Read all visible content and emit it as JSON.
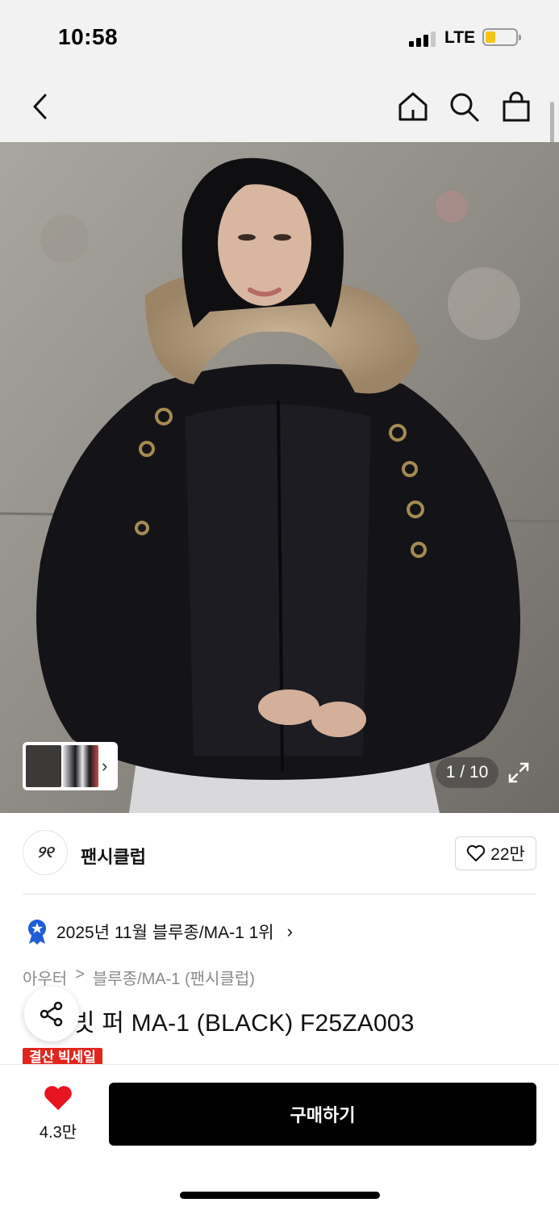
{
  "status_bar": {
    "time": "10:58",
    "network": "LTE",
    "battery_color": "#f5c518"
  },
  "nav": {
    "back_icon": "chevron-left-icon",
    "home_icon": "home-icon",
    "search_icon": "search-icon",
    "cart_icon": "shopping-bag-icon"
  },
  "gallery": {
    "counter": "1 / 10",
    "expand_icon": "expand-icon",
    "thumbnail_arrow": "›"
  },
  "brand": {
    "logo_text": "୨୧",
    "name": "팬시클럽",
    "likes": "22만"
  },
  "ranking": {
    "text": "2025년 11월 블루종/MA-1 1위",
    "badge_icon": "ranking-medal-icon",
    "badge_color": "#1f5fd6"
  },
  "breadcrumb": {
    "category": "아우터",
    "separator": ">",
    "subcategory": "블루종/MA-1 (팬시클럽)"
  },
  "product": {
    "title": "빗 퍼 MA-1 (BLACK) F25ZA003",
    "sale_badge": "결산 빅세일",
    "sale_color": "#e0261c"
  },
  "bottom_bar": {
    "wish_count": "4.3만",
    "wish_color": "#e8141f",
    "buy_label": "구매하기"
  }
}
